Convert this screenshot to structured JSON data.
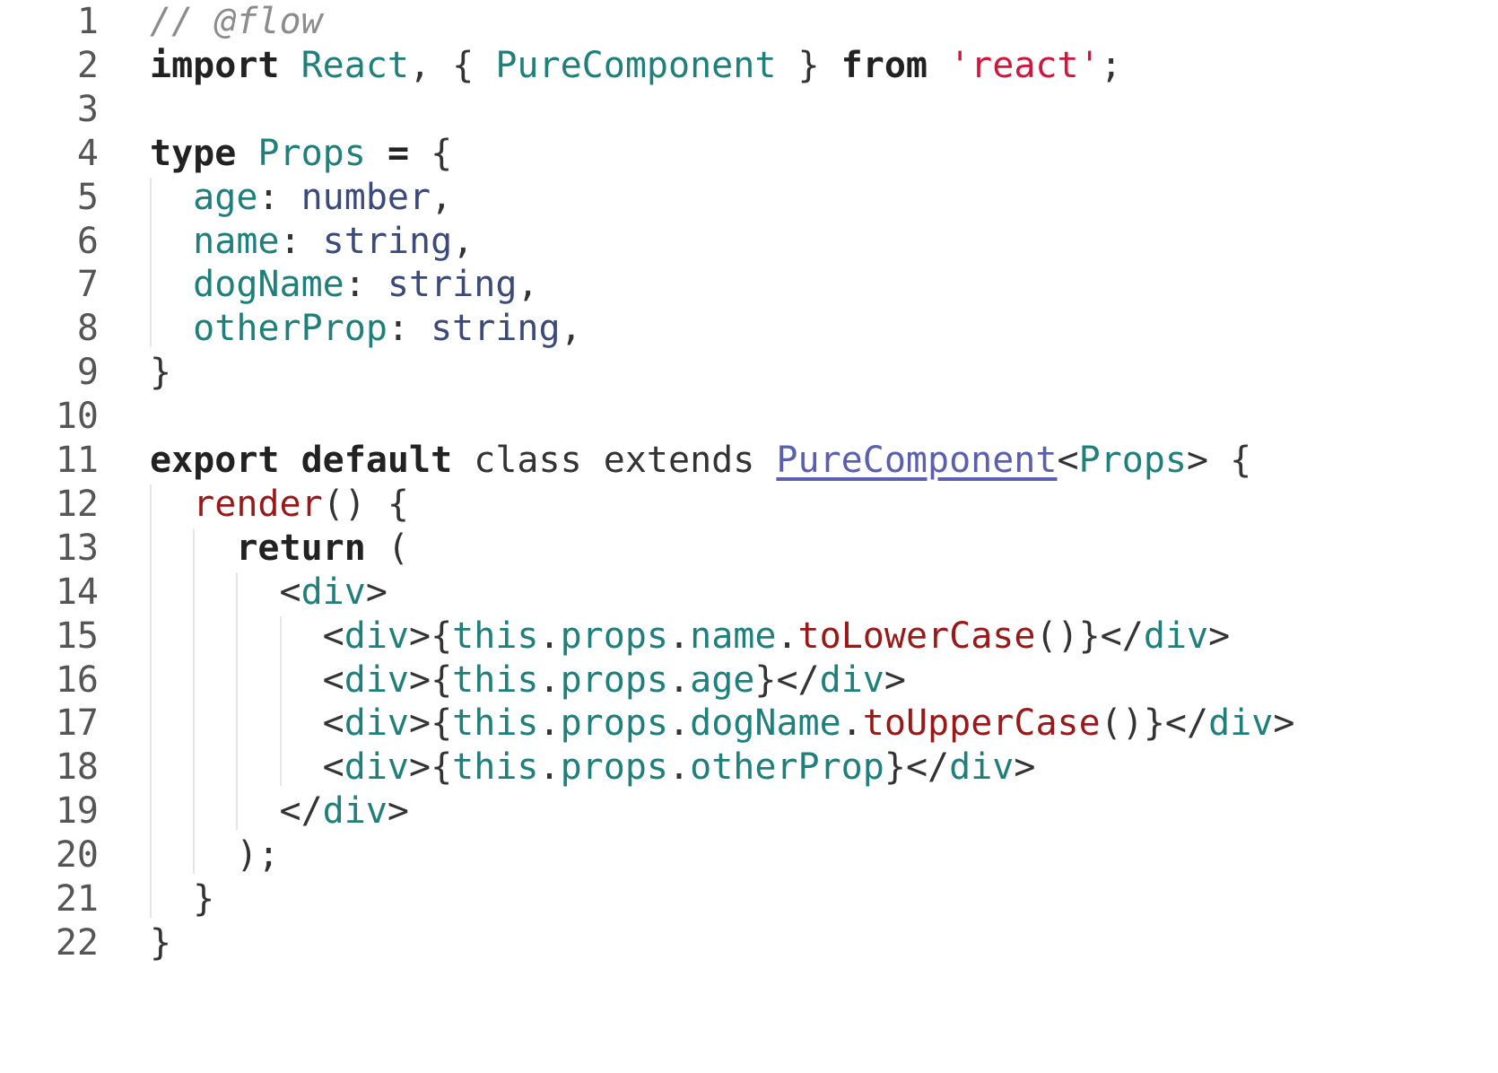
{
  "editor": {
    "lines": [
      {
        "number": "1",
        "tokens": [
          {
            "t": "// @flow",
            "c": "comment"
          }
        ]
      },
      {
        "number": "2",
        "tokens": [
          {
            "t": "import",
            "c": "keyword"
          },
          {
            "t": " ",
            "c": "plain"
          },
          {
            "t": "React",
            "c": "ident"
          },
          {
            "t": ", { ",
            "c": "punct"
          },
          {
            "t": "PureComponent",
            "c": "ident"
          },
          {
            "t": " } ",
            "c": "punct"
          },
          {
            "t": "from",
            "c": "keyword"
          },
          {
            "t": " ",
            "c": "plain"
          },
          {
            "t": "'react'",
            "c": "string"
          },
          {
            "t": ";",
            "c": "punct"
          }
        ]
      },
      {
        "number": "3",
        "tokens": []
      },
      {
        "number": "4",
        "tokens": [
          {
            "t": "type",
            "c": "keyword"
          },
          {
            "t": " ",
            "c": "plain"
          },
          {
            "t": "Props",
            "c": "ident"
          },
          {
            "t": " ",
            "c": "plain"
          },
          {
            "t": "=",
            "c": "keyword"
          },
          {
            "t": " {",
            "c": "punct"
          }
        ]
      },
      {
        "number": "5",
        "tokens": [
          {
            "t": "  ",
            "c": "plain"
          },
          {
            "t": "age",
            "c": "prop"
          },
          {
            "t": ": ",
            "c": "punct"
          },
          {
            "t": "number",
            "c": "type"
          },
          {
            "t": ",",
            "c": "punct"
          }
        ]
      },
      {
        "number": "6",
        "tokens": [
          {
            "t": "  ",
            "c": "plain"
          },
          {
            "t": "name",
            "c": "prop"
          },
          {
            "t": ": ",
            "c": "punct"
          },
          {
            "t": "string",
            "c": "type"
          },
          {
            "t": ",",
            "c": "punct"
          }
        ]
      },
      {
        "number": "7",
        "tokens": [
          {
            "t": "  ",
            "c": "plain"
          },
          {
            "t": "dogName",
            "c": "prop"
          },
          {
            "t": ": ",
            "c": "punct"
          },
          {
            "t": "string",
            "c": "type"
          },
          {
            "t": ",",
            "c": "punct"
          }
        ]
      },
      {
        "number": "8",
        "tokens": [
          {
            "t": "  ",
            "c": "plain"
          },
          {
            "t": "otherProp",
            "c": "prop"
          },
          {
            "t": ": ",
            "c": "punct"
          },
          {
            "t": "string",
            "c": "type"
          },
          {
            "t": ",",
            "c": "punct"
          }
        ]
      },
      {
        "number": "9",
        "tokens": [
          {
            "t": "}",
            "c": "punct"
          }
        ]
      },
      {
        "number": "10",
        "tokens": []
      },
      {
        "number": "11",
        "tokens": [
          {
            "t": "export",
            "c": "keyword"
          },
          {
            "t": " ",
            "c": "plain"
          },
          {
            "t": "default",
            "c": "keyword"
          },
          {
            "t": " class extends ",
            "c": "plain"
          },
          {
            "t": "PureComponent",
            "c": "link"
          },
          {
            "t": "<",
            "c": "punct"
          },
          {
            "t": "Props",
            "c": "ident"
          },
          {
            "t": "> {",
            "c": "punct"
          }
        ]
      },
      {
        "number": "12",
        "tokens": [
          {
            "t": "  ",
            "c": "plain"
          },
          {
            "t": "render",
            "c": "method"
          },
          {
            "t": "() {",
            "c": "punct"
          }
        ]
      },
      {
        "number": "13",
        "tokens": [
          {
            "t": "    ",
            "c": "plain"
          },
          {
            "t": "return",
            "c": "keyword"
          },
          {
            "t": " (",
            "c": "punct"
          }
        ]
      },
      {
        "number": "14",
        "tokens": [
          {
            "t": "      ",
            "c": "plain"
          },
          {
            "t": "<",
            "c": "punct"
          },
          {
            "t": "div",
            "c": "tag"
          },
          {
            "t": ">",
            "c": "punct"
          }
        ]
      },
      {
        "number": "15",
        "tokens": [
          {
            "t": "        ",
            "c": "plain"
          },
          {
            "t": "<",
            "c": "punct"
          },
          {
            "t": "div",
            "c": "tag"
          },
          {
            "t": ">{",
            "c": "punct"
          },
          {
            "t": "this",
            "c": "ident"
          },
          {
            "t": ".",
            "c": "punct"
          },
          {
            "t": "props",
            "c": "prop"
          },
          {
            "t": ".",
            "c": "punct"
          },
          {
            "t": "name",
            "c": "prop"
          },
          {
            "t": ".",
            "c": "punct"
          },
          {
            "t": "toLowerCase",
            "c": "method"
          },
          {
            "t": "()}</",
            "c": "punct"
          },
          {
            "t": "div",
            "c": "tag"
          },
          {
            "t": ">",
            "c": "punct"
          }
        ]
      },
      {
        "number": "16",
        "tokens": [
          {
            "t": "        ",
            "c": "plain"
          },
          {
            "t": "<",
            "c": "punct"
          },
          {
            "t": "div",
            "c": "tag"
          },
          {
            "t": ">{",
            "c": "punct"
          },
          {
            "t": "this",
            "c": "ident"
          },
          {
            "t": ".",
            "c": "punct"
          },
          {
            "t": "props",
            "c": "prop"
          },
          {
            "t": ".",
            "c": "punct"
          },
          {
            "t": "age",
            "c": "prop"
          },
          {
            "t": "}</",
            "c": "punct"
          },
          {
            "t": "div",
            "c": "tag"
          },
          {
            "t": ">",
            "c": "punct"
          }
        ]
      },
      {
        "number": "17",
        "tokens": [
          {
            "t": "        ",
            "c": "plain"
          },
          {
            "t": "<",
            "c": "punct"
          },
          {
            "t": "div",
            "c": "tag"
          },
          {
            "t": ">{",
            "c": "punct"
          },
          {
            "t": "this",
            "c": "ident"
          },
          {
            "t": ".",
            "c": "punct"
          },
          {
            "t": "props",
            "c": "prop"
          },
          {
            "t": ".",
            "c": "punct"
          },
          {
            "t": "dogName",
            "c": "prop"
          },
          {
            "t": ".",
            "c": "punct"
          },
          {
            "t": "toUpperCase",
            "c": "method"
          },
          {
            "t": "()}</",
            "c": "punct"
          },
          {
            "t": "div",
            "c": "tag"
          },
          {
            "t": ">",
            "c": "punct"
          }
        ]
      },
      {
        "number": "18",
        "tokens": [
          {
            "t": "        ",
            "c": "plain"
          },
          {
            "t": "<",
            "c": "punct"
          },
          {
            "t": "div",
            "c": "tag"
          },
          {
            "t": ">{",
            "c": "punct"
          },
          {
            "t": "this",
            "c": "ident"
          },
          {
            "t": ".",
            "c": "punct"
          },
          {
            "t": "props",
            "c": "prop"
          },
          {
            "t": ".",
            "c": "punct"
          },
          {
            "t": "otherProp",
            "c": "prop"
          },
          {
            "t": "}</",
            "c": "punct"
          },
          {
            "t": "div",
            "c": "tag"
          },
          {
            "t": ">",
            "c": "punct"
          }
        ]
      },
      {
        "number": "19",
        "tokens": [
          {
            "t": "      ",
            "c": "plain"
          },
          {
            "t": "</",
            "c": "punct"
          },
          {
            "t": "div",
            "c": "tag"
          },
          {
            "t": ">",
            "c": "punct"
          }
        ]
      },
      {
        "number": "20",
        "tokens": [
          {
            "t": "    ",
            "c": "plain"
          },
          {
            "t": ");",
            "c": "punct"
          }
        ]
      },
      {
        "number": "21",
        "tokens": [
          {
            "t": "  ",
            "c": "plain"
          },
          {
            "t": "}",
            "c": "punct"
          }
        ]
      },
      {
        "number": "22",
        "tokens": [
          {
            "t": "}",
            "c": "punct"
          }
        ]
      }
    ]
  },
  "colors": {
    "background": "#ffffff",
    "comment": "#8c8c8c",
    "keyword": "#222222",
    "identifier": "#1f7f7a",
    "type": "#3b4a7a",
    "string": "#d0163c",
    "method": "#9a1818",
    "link": "#5a5fb0",
    "line_number": "#555555"
  }
}
